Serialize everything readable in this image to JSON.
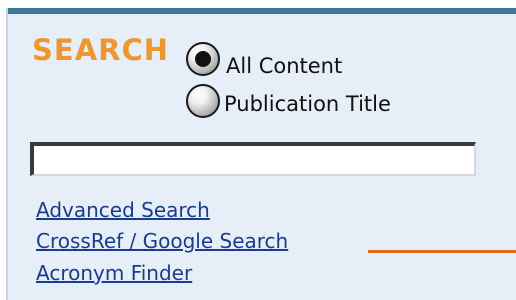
{
  "search": {
    "title": "SEARCH",
    "input_value": "",
    "input_placeholder": ""
  },
  "radios": [
    {
      "label": "All Content",
      "checked": true
    },
    {
      "label": "Publication Title",
      "checked": false
    }
  ],
  "links": {
    "advanced": "Advanced Search",
    "crossref": "CrossRef / Google Search",
    "acronym": "Acronym Finder"
  },
  "colors": {
    "title": "#f09630",
    "accent_rule": "#e8651c",
    "panel_border": "#3d7896",
    "panel_bg": "#e6eef7",
    "link": "#1a3c8c"
  }
}
